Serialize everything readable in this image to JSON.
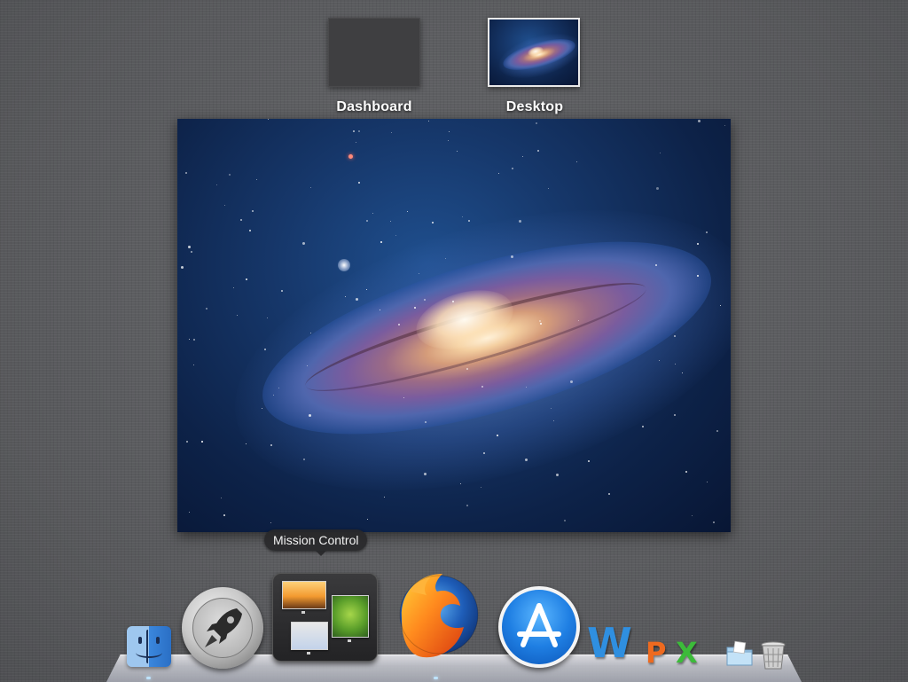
{
  "spaces": {
    "dashboard_label": "Dashboard",
    "desktop_label": "Desktop"
  },
  "tooltip": {
    "text": "Mission Control"
  },
  "dock": {
    "items": [
      {
        "name": "Finder",
        "icon": "finder-icon"
      },
      {
        "name": "Launchpad",
        "icon": "rocket-icon"
      },
      {
        "name": "Mission Control",
        "icon": "mission-control-icon"
      },
      {
        "name": "Firefox",
        "icon": "firefox-icon"
      },
      {
        "name": "App Store",
        "icon": "app-store-icon"
      },
      {
        "name": "Word",
        "icon": "word-icon",
        "glyph": "W"
      },
      {
        "name": "PowerPoint",
        "icon": "powerpoint-icon",
        "glyph": "P"
      },
      {
        "name": "Excel",
        "icon": "excel-icon",
        "glyph": "X"
      },
      {
        "name": "Documents",
        "icon": "folder-icon"
      },
      {
        "name": "Trash",
        "icon": "trash-icon"
      }
    ]
  },
  "colors": {
    "background": "#5d5e61",
    "word": "#2f8fe0",
    "powerpoint": "#ee6a1f",
    "excel": "#3cbb3a",
    "app_store": "#1f7fe3",
    "indicator": "#bfe4ff"
  }
}
